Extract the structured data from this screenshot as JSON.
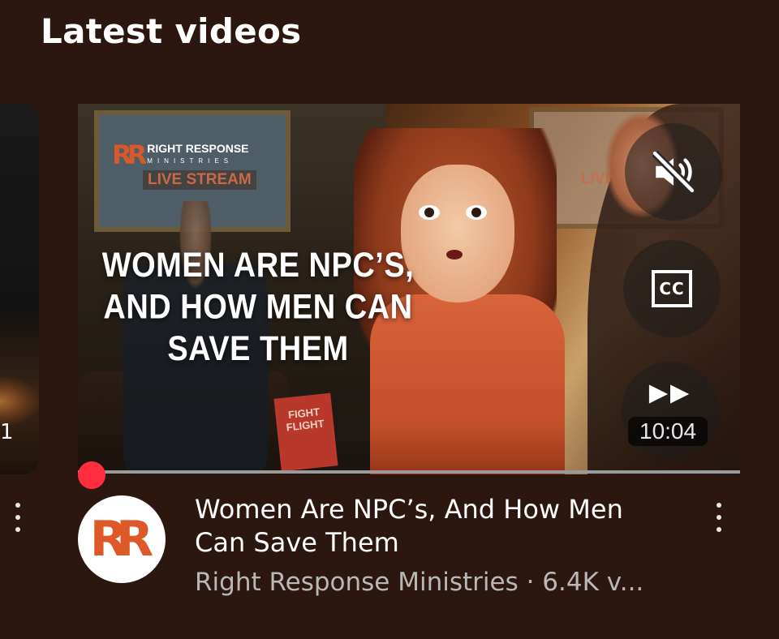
{
  "section": {
    "title": "Latest videos"
  },
  "previous_card": {
    "badge": "1"
  },
  "video": {
    "thumbnail": {
      "overlay_title_lines": [
        "WOMEN ARE NPC’S,",
        "AND HOW MEN CAN",
        "SAVE THEM"
      ],
      "brand_logo": {
        "mark": "RR",
        "name": "RIGHT RESPONSE",
        "sub": "MINISTRIES"
      },
      "live_stream_label": "LIVE STREAM",
      "book_text": "FIGHT FLIGHT"
    },
    "controls": {
      "mute_icon": "speaker-muted-icon",
      "cc_label": "CC",
      "fast_forward_icon": "fast-forward-icon",
      "duration": "10:04"
    },
    "progress": {
      "fraction": 0.0
    },
    "channel_avatar": "RR",
    "title": "Women Are NPC’s, And How Men Can Save Them",
    "meta": "Right Response Ministries · 6.4K v..."
  },
  "colors": {
    "background": "#2b1710",
    "progress_accent": "#ff2d3e",
    "brand_orange": "#dd5a28",
    "meta_text": "#b8b8b8"
  }
}
